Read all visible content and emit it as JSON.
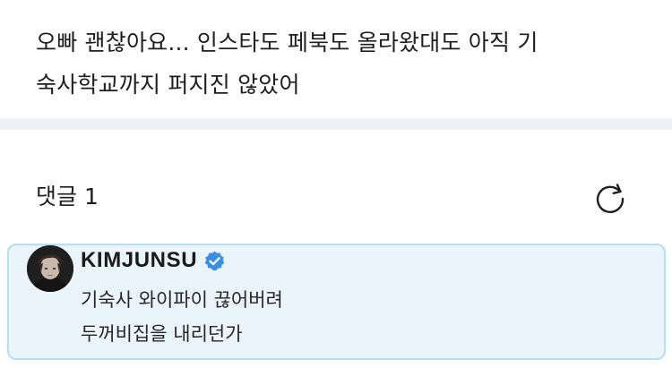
{
  "post": {
    "body": "오빠 괜찮아요... 인스타도 페북도 올라왔대도 아직 기\n숙사학교까지 퍼지진 않았어"
  },
  "comments": {
    "title": "댓글",
    "count": "1",
    "refresh_icon": "refresh-icon",
    "items": [
      {
        "author": "KIMJUNSU",
        "verified": true,
        "verified_color": "#3a8ee6",
        "text": "기숙사 와이파이 끊어버려\n두꺼비집을 내리던가"
      }
    ]
  },
  "colors": {
    "card_background": "#eaf4fb",
    "card_border": "#b5def6",
    "divider": "#eef0f3"
  }
}
